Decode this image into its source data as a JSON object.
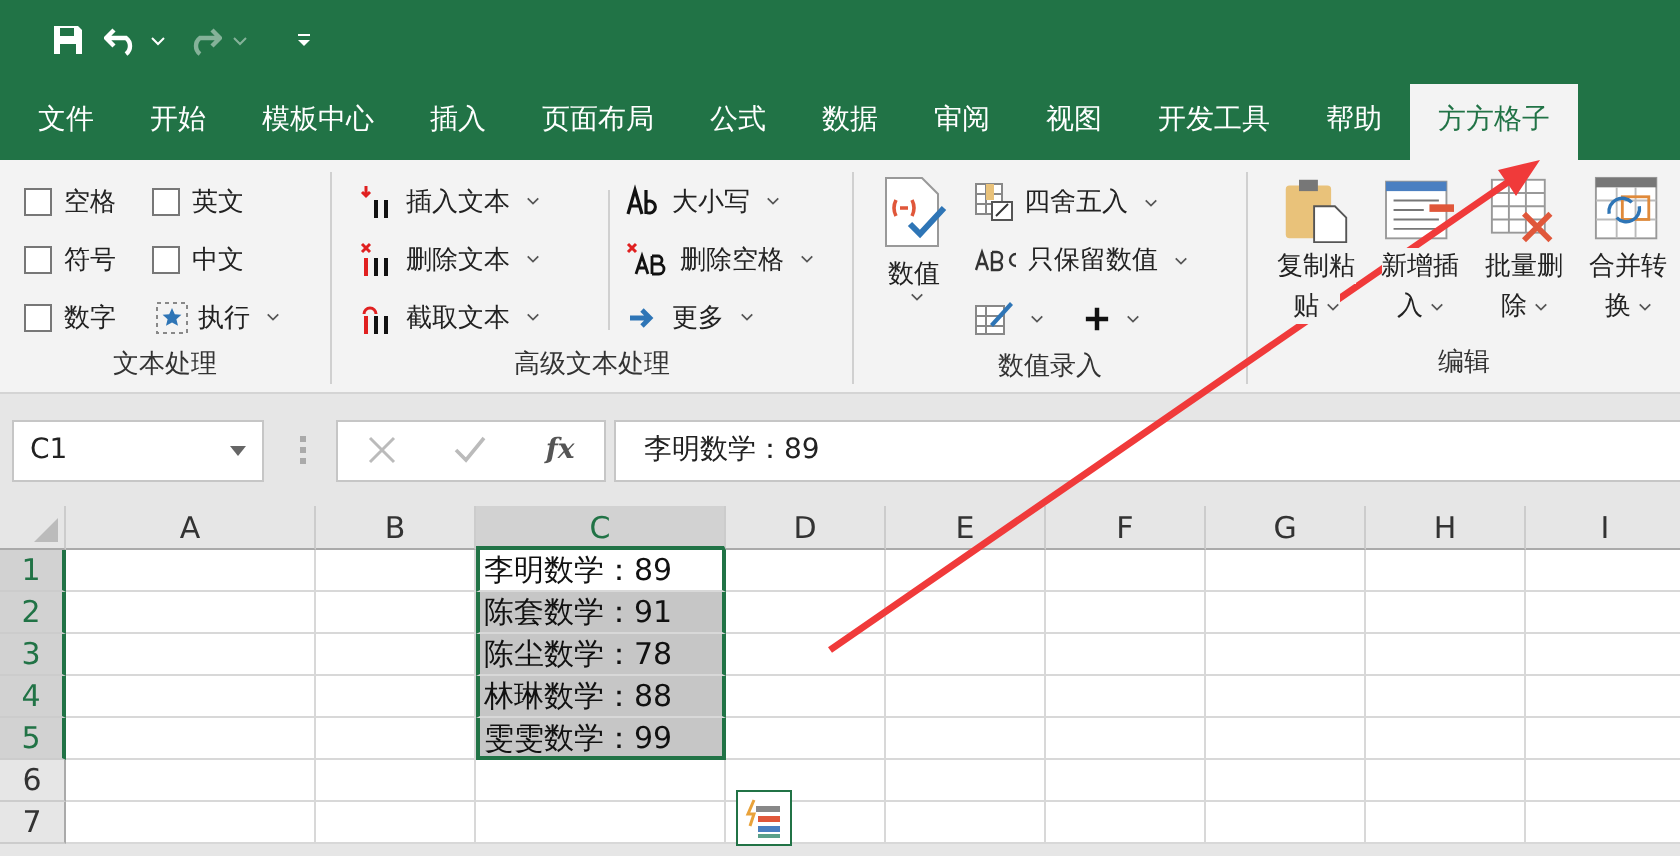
{
  "tabs": [
    {
      "label": "文件",
      "selected": false
    },
    {
      "label": "开始",
      "selected": false
    },
    {
      "label": "模板中心",
      "selected": false
    },
    {
      "label": "插入",
      "selected": false
    },
    {
      "label": "页面布局",
      "selected": false
    },
    {
      "label": "公式",
      "selected": false
    },
    {
      "label": "数据",
      "selected": false
    },
    {
      "label": "审阅",
      "selected": false
    },
    {
      "label": "视图",
      "selected": false
    },
    {
      "label": "开发工具",
      "selected": false
    },
    {
      "label": "帮助",
      "selected": false
    },
    {
      "label": "方方格子",
      "selected": true
    }
  ],
  "ribbon": {
    "text_group": {
      "title": "文本处理",
      "checkboxes": [
        {
          "label": "空格",
          "checked": false
        },
        {
          "label": "符号",
          "checked": false
        },
        {
          "label": "数字",
          "checked": false
        },
        {
          "label": "英文",
          "checked": false
        },
        {
          "label": "中文",
          "checked": false
        }
      ],
      "execute": "执行"
    },
    "advanced_group": {
      "title": "高级文本处理",
      "buttons": [
        {
          "label": "插入文本",
          "kind": "insert"
        },
        {
          "label": "删除文本",
          "kind": "delete"
        },
        {
          "label": "截取文本",
          "kind": "cut"
        },
        {
          "label": "大小写",
          "kind": "case"
        },
        {
          "label": "删除空格",
          "kind": "space"
        },
        {
          "label": "更多",
          "kind": "more"
        }
      ]
    },
    "number_group": {
      "title": "数值录入",
      "big_button": "数值",
      "buttons": [
        {
          "label": "四舍五入",
          "kind": "round"
        },
        {
          "label": "只保留数值",
          "kind": "abc"
        }
      ]
    },
    "edit_group": {
      "title": "编辑",
      "buttons": [
        {
          "lines": [
            "复制粘",
            "贴"
          ],
          "kind": "paste"
        },
        {
          "lines": [
            "新增插",
            "入"
          ],
          "kind": "insert-row"
        },
        {
          "lines": [
            "批量删",
            "除"
          ],
          "kind": "delete-rows"
        },
        {
          "lines": [
            "合并转",
            "换"
          ],
          "kind": "merge"
        }
      ]
    }
  },
  "formula_bar": {
    "name_box": "C1",
    "function_label": "fx",
    "formula": "李明数学：89"
  },
  "sheet": {
    "columns": [
      {
        "label": "A",
        "selected": false
      },
      {
        "label": "B",
        "selected": false
      },
      {
        "label": "C",
        "selected": true
      },
      {
        "label": "D",
        "selected": false
      },
      {
        "label": "E",
        "selected": false
      },
      {
        "label": "F",
        "selected": false
      },
      {
        "label": "G",
        "selected": false
      },
      {
        "label": "H",
        "selected": false
      },
      {
        "label": "I",
        "selected": false
      }
    ],
    "rows": [
      {
        "header": "1",
        "selected": true,
        "cell_c": {
          "text": "李明数学：89",
          "active": true
        }
      },
      {
        "header": "2",
        "selected": true,
        "cell_c": {
          "text": "陈套数学：91",
          "active": false
        }
      },
      {
        "header": "3",
        "selected": true,
        "cell_c": {
          "text": "陈尘数学：78",
          "active": false
        }
      },
      {
        "header": "4",
        "selected": true,
        "cell_c": {
          "text": "林琳数学：88",
          "active": false
        }
      },
      {
        "header": "5",
        "selected": true,
        "cell_c": {
          "text": "雯雯数学：99",
          "active": false
        }
      },
      {
        "header": "6",
        "selected": false
      },
      {
        "header": "7",
        "selected": false
      }
    ]
  },
  "annotation": {
    "kind": "arrow"
  }
}
